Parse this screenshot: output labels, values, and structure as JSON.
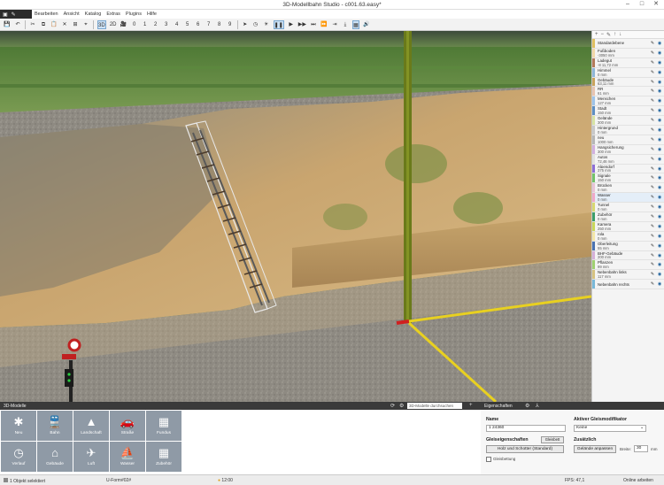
{
  "window": {
    "title": "3D-Modellbahn Studio - c001.63.easy*"
  },
  "menu": [
    "Bearbeiten",
    "Ansicht",
    "Katalog",
    "Extras",
    "Plugins",
    "Hilfe"
  ],
  "toolbar": {
    "mode3d": "3D",
    "mode2d": "2D",
    "cams": [
      "0",
      "1",
      "2",
      "3",
      "4",
      "5",
      "6",
      "7",
      "8",
      "9"
    ]
  },
  "layers": [
    {
      "name": "Standardebene",
      "height": "",
      "color": "#e0c060"
    },
    {
      "name": "Fußboden",
      "height": "-3050 mm",
      "color": "#f2d8a8"
    },
    {
      "name": "Ladegut",
      "height": "-8 11,72 mm",
      "color": "#b47a5a"
    },
    {
      "name": "Himmel",
      "height": "0 mm",
      "color": "#8fb7d8"
    },
    {
      "name": "Gebäude",
      "height": "63,11 mm",
      "color": "#c9a35c"
    },
    {
      "name": "RR",
      "height": "61 mm",
      "color": "#e8c4b0"
    },
    {
      "name": "Menschen",
      "height": "127 mm",
      "color": "#9ec3e8"
    },
    {
      "name": "Stadt",
      "height": "150 mm",
      "color": "#5e8fc2"
    },
    {
      "name": "Gelände",
      "height": "300 mm",
      "color": "#d7e3a4"
    },
    {
      "name": "Hintergrund",
      "height": "0 mm",
      "color": "#c8c8c8"
    },
    {
      "name": "neu",
      "height": "1000 mm",
      "color": "#b6b6b6"
    },
    {
      "name": "Hangsicherung",
      "height": "300 mm",
      "color": "#d2b0de"
    },
    {
      "name": "Autos",
      "height": "72,46 mm",
      "color": "#e1e1e1"
    },
    {
      "name": "Alpendorf",
      "height": "375 mm",
      "color": "#8e6fd6"
    },
    {
      "name": "Signale",
      "height": "150 mm",
      "color": "#73c26a"
    },
    {
      "name": "Brücken",
      "height": "0 mm",
      "color": "#e8c3d6"
    },
    {
      "name": "Wasser",
      "height": "0 mm",
      "color": "#f0a8c8",
      "highlight": true
    },
    {
      "name": "Tunnel",
      "height": "0 mm",
      "color": "#d8d870"
    },
    {
      "name": "Zubehör",
      "height": "0 mm",
      "color": "#3c9e6a"
    },
    {
      "name": "Kamera",
      "height": "250 mm",
      "color": "#c9d75a"
    },
    {
      "name": "rola",
      "height": "0 mm",
      "color": "#f4e6a8"
    },
    {
      "name": "Oberleitung",
      "height": "55 mm",
      "color": "#4a72b0"
    },
    {
      "name": "BHF-Gebäude",
      "height": "200 mm",
      "color": "#d5b0d8"
    },
    {
      "name": "Pflanzen",
      "height": "99 mm",
      "color": "#a0d070"
    },
    {
      "name": "Nebenbahn links",
      "height": "117 mm",
      "color": "#d6c280"
    },
    {
      "name": "Nebenbahn rechts",
      "height": "",
      "color": "#78b8d8"
    }
  ],
  "models_panel": {
    "title": "3D-Modelle",
    "search_placeholder": "3D-Modelle durchsuchen",
    "tiles": [
      {
        "label": "Neu",
        "icon": "✱"
      },
      {
        "label": "Bahn",
        "icon": "🚆"
      },
      {
        "label": "Landschaft",
        "icon": "▲"
      },
      {
        "label": "Straße",
        "icon": "🚗"
      },
      {
        "label": "Fundus",
        "icon": "▦"
      },
      {
        "label": "Verlauf",
        "icon": "◷"
      },
      {
        "label": "Gebäude",
        "icon": "⌂"
      },
      {
        "label": "Luft",
        "icon": "✈"
      },
      {
        "label": "Wasser",
        "icon": "⛵"
      },
      {
        "label": "Zubehör",
        "icon": "▦"
      }
    ]
  },
  "props_panel": {
    "title": "Eigenschaften",
    "name_label": "Name",
    "name_value": "1 24360",
    "gleis_label": "Gleiseigenschaften",
    "gleis_btn_small": "Gleisbett",
    "gleis_button": "Holz und Schotter (Standard)",
    "checkbox_label": "Gleisbettung",
    "active_label": "Aktiver Gleismodifikator",
    "active_value": "Keine",
    "extra_label": "Zusätzlich",
    "terrain_button": "Gelände anpassen",
    "width_label": "Breite:",
    "width_value": "30",
    "width_unit": "mm"
  },
  "status": {
    "selected": "1 Objekt selektiert",
    "preset": "U-Form#02#",
    "time": "12:00",
    "fps": "FPS: 47,1",
    "online": "Online arbeiten"
  },
  "colors": {
    "accent": "#4a8ac8",
    "ui_dark": "#3a3a3a",
    "tile": "#8f9aa6"
  }
}
